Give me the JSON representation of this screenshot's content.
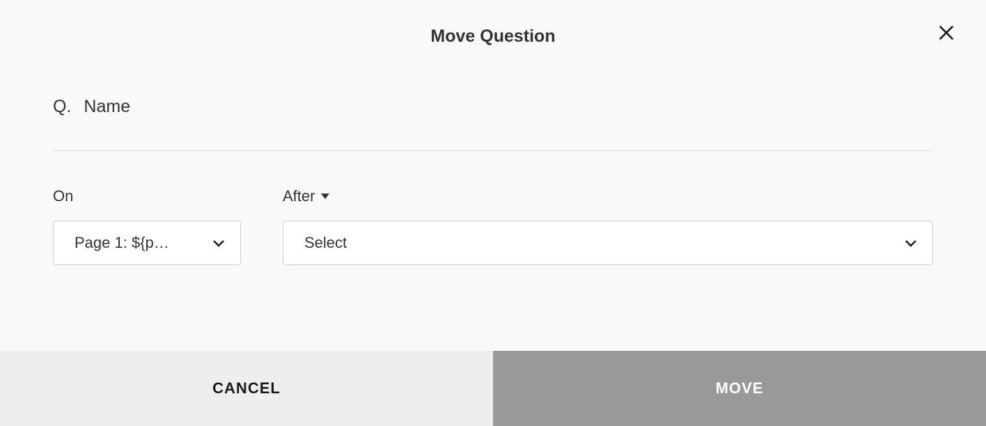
{
  "dialog": {
    "title": "Move Question"
  },
  "question": {
    "prefix": "Q.",
    "name": "Name"
  },
  "fields": {
    "on": {
      "label": "On",
      "value": "Page 1: ${p…"
    },
    "after": {
      "label": "After",
      "value": "Select"
    }
  },
  "buttons": {
    "cancel": "CANCEL",
    "move": "MOVE"
  }
}
